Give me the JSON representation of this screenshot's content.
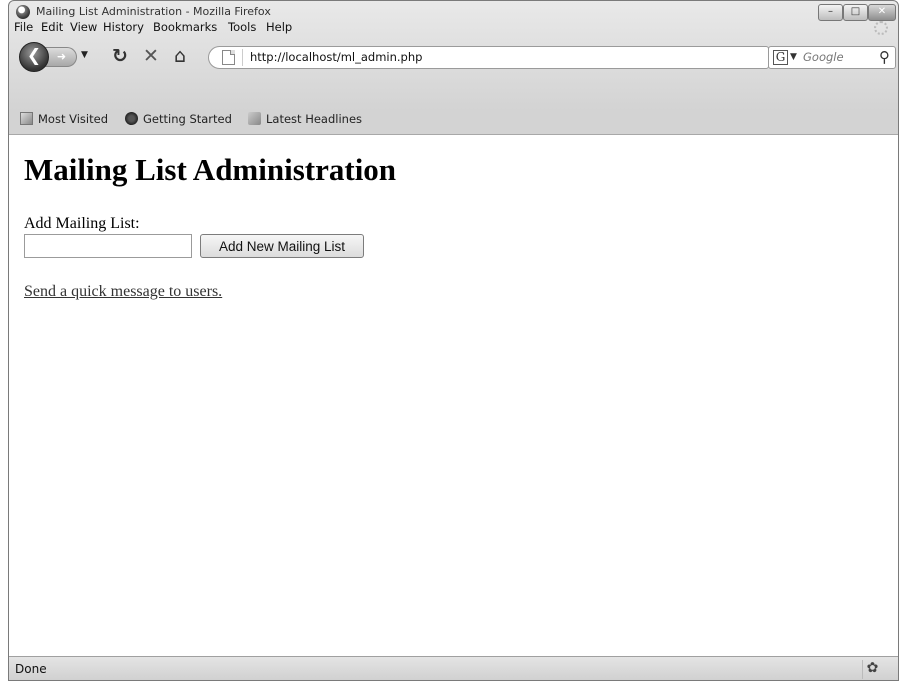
{
  "window": {
    "title": "Mailing List Administration - Mozilla Firefox"
  },
  "menu": [
    {
      "label": "File",
      "name": "menu-file"
    },
    {
      "label": "Edit",
      "name": "menu-edit"
    },
    {
      "label": "View",
      "name": "menu-view"
    },
    {
      "label": "History",
      "name": "menu-history"
    },
    {
      "label": "Bookmarks",
      "name": "menu-bookmarks"
    },
    {
      "label": "Tools",
      "name": "menu-tools"
    },
    {
      "label": "Help",
      "name": "menu-help"
    }
  ],
  "nav": {
    "url": "http://localhost/ml_admin.php",
    "search_placeholder": "Google"
  },
  "bookmarks": [
    {
      "label": "Most Visited"
    },
    {
      "label": "Getting Started"
    },
    {
      "label": "Latest Headlines"
    }
  ],
  "page": {
    "title": "Mailing List Administration",
    "add_label": "Add Mailing List:",
    "list_name_value": "",
    "add_button": "Add New Mailing List",
    "quick_message_link": "Send a quick message to users."
  },
  "status": {
    "text": "Done"
  },
  "icons": {
    "back": "back-arrow-icon",
    "forward": "forward-arrow-icon",
    "reload": "reload-icon",
    "stop": "stop-icon",
    "home": "home-icon",
    "bookmark": "star-icon",
    "search": "search-icon"
  }
}
